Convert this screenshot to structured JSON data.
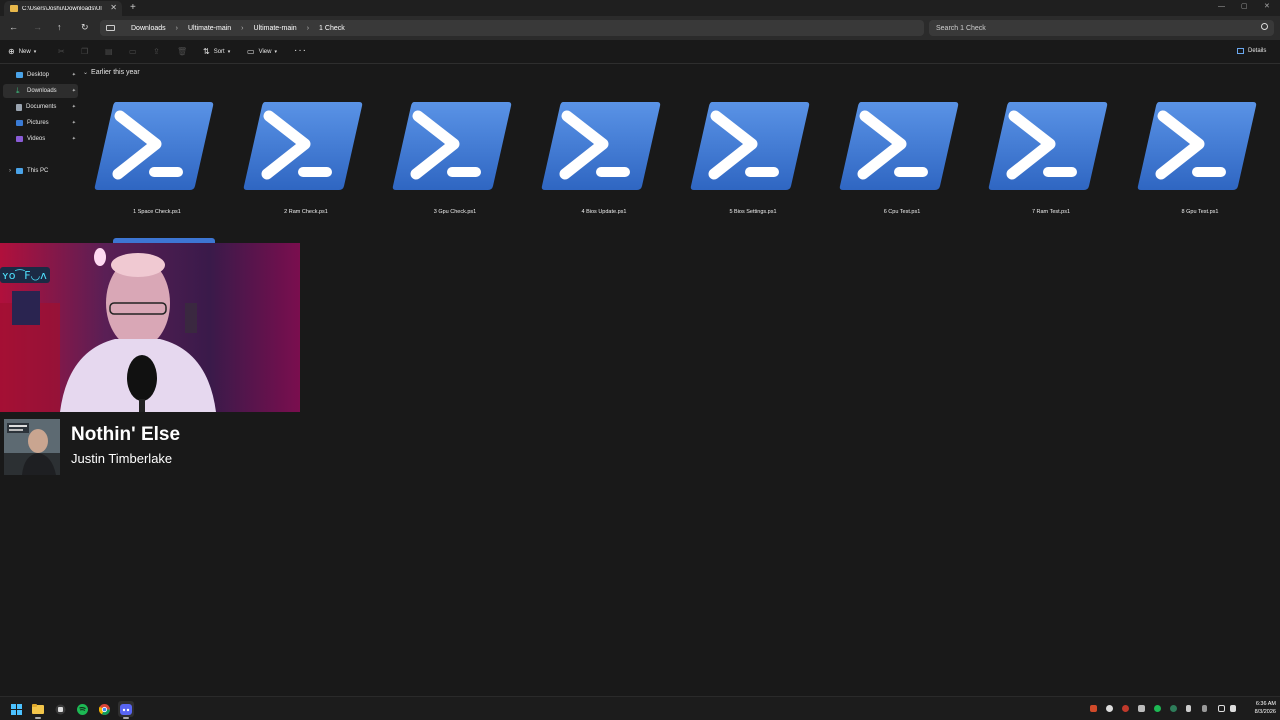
{
  "window": {
    "tab_title": "C:\\Users\\Joshu\\Downloads\\Ul",
    "tab_close": "✕",
    "new_tab": "+",
    "controls": [
      "—",
      "▢",
      "✕"
    ]
  },
  "nav": {
    "back": "←",
    "forward": "→",
    "up": "↑",
    "refresh": "↻"
  },
  "breadcrumb": [
    "Downloads",
    "Ultimate-main",
    "Ultimate-main",
    "1 Check"
  ],
  "breadcrumb_separator": "›",
  "search": {
    "placeholder": "Search 1 Check"
  },
  "toolbar": {
    "new_label": "New",
    "sort_label": "Sort",
    "view_label": "View",
    "more_label": "···",
    "details_label": "Details"
  },
  "sidebar": {
    "items": [
      {
        "label": "Desktop",
        "icon": "desktop-icon",
        "color": "#4aa3e8"
      },
      {
        "label": "Downloads",
        "icon": "downloads-icon",
        "color": "#3fbf7f"
      },
      {
        "label": "Documents",
        "icon": "documents-icon",
        "color": "#9aa4b0"
      },
      {
        "label": "Pictures",
        "icon": "pictures-icon",
        "color": "#3a7bd5"
      },
      {
        "label": "Videos",
        "icon": "videos-icon",
        "color": "#8a5cd6"
      }
    ],
    "this_pc": "This PC",
    "pin_glyph": "📌",
    "active_index": 1
  },
  "content": {
    "group_label": "Earlier this year",
    "files": [
      {
        "name": "1 Space Check.ps1"
      },
      {
        "name": "2 Ram Check.ps1"
      },
      {
        "name": "3 Gpu Check.ps1"
      },
      {
        "name": "4 Bios Update.ps1"
      },
      {
        "name": "5 Bios Settings.ps1"
      },
      {
        "name": "6 Cpu Test.ps1"
      },
      {
        "name": "7 Ram Test.ps1"
      },
      {
        "name": "8 Gpu Test.ps1"
      }
    ],
    "file_icon": "powershell-icon"
  },
  "now_playing": {
    "title": "Nothin' Else",
    "artist": "Justin Timberlake"
  },
  "taskbar": {
    "apps": [
      "windows-start-icon",
      "file-explorer-icon",
      "app-icon",
      "spotify-icon",
      "chrome-icon",
      "discord-icon"
    ],
    "time": "6:36 AM",
    "date": "8/3/2026"
  },
  "colors": {
    "accent": "#6aa7ee",
    "powershell_blue": "#3d76d3",
    "spotify_green": "#1db954",
    "discord": "#5865f2"
  }
}
